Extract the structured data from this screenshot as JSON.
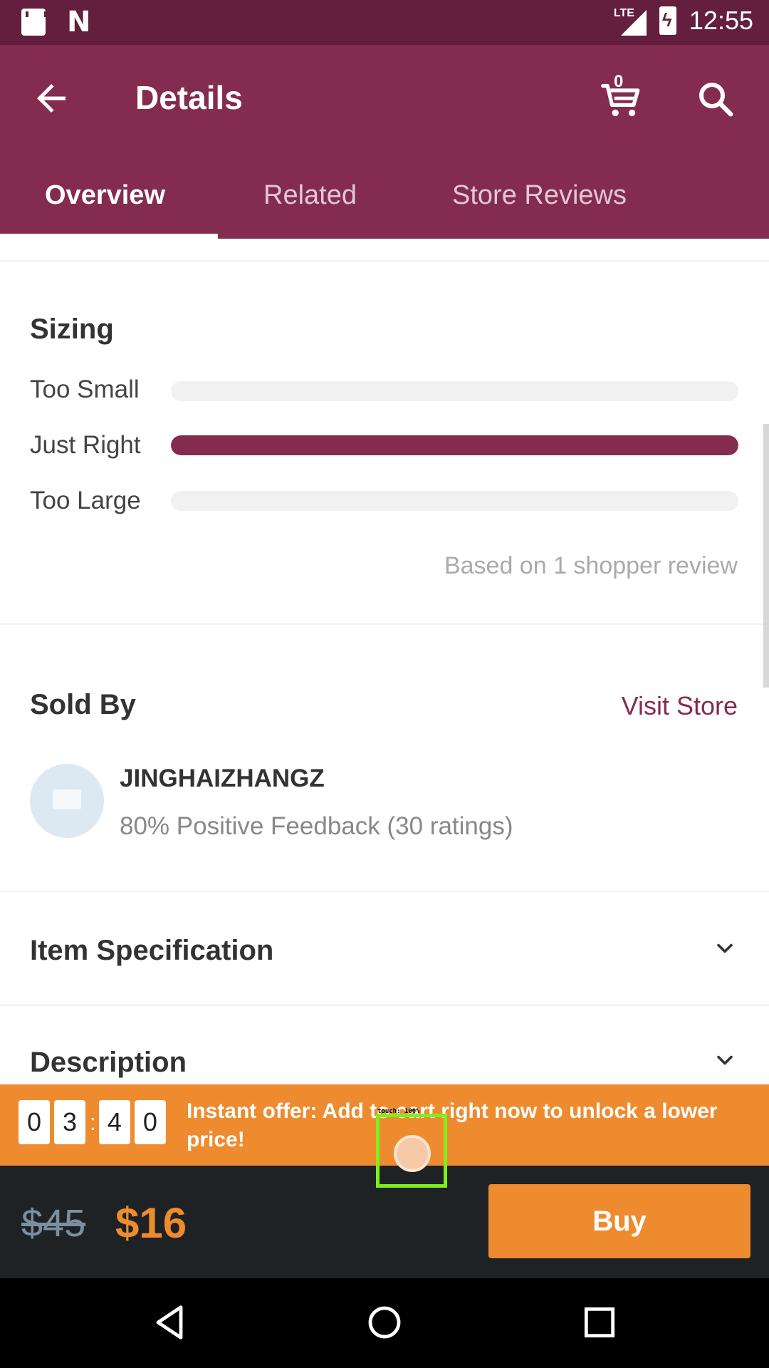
{
  "status_bar": {
    "time": "12:55",
    "network": "LTE"
  },
  "app_bar": {
    "title": "Details",
    "cart_count": "0"
  },
  "tabs": [
    {
      "label": "Overview",
      "active": true
    },
    {
      "label": "Related",
      "active": false
    },
    {
      "label": "Store Reviews",
      "active": false
    }
  ],
  "sizing": {
    "title": "Sizing",
    "rows": [
      {
        "label": "Too Small",
        "fraction": 0
      },
      {
        "label": "Just Right",
        "fraction": 1
      },
      {
        "label": "Too Large",
        "fraction": 0
      }
    ],
    "based_on": "Based on 1 shopper review"
  },
  "sold_by": {
    "title": "Sold By",
    "visit_store": "Visit Store",
    "store_name": "JINGHAIZHANGZ",
    "feedback": "80% Positive Feedback (30 ratings)"
  },
  "sections": {
    "item_spec": "Item Specification",
    "description": "Description"
  },
  "offer": {
    "timer_digits": [
      "0",
      "3",
      "4",
      "0"
    ],
    "separator": ":",
    "text": "Instant offer: Add to cart right now to unlock a lower price!",
    "touch_label": "touch: 100%"
  },
  "buy_bar": {
    "old_price": "$45",
    "new_price": "$16",
    "buy_label": "Buy"
  },
  "colors": {
    "brand": "#842b50",
    "status_bar": "#631f3d",
    "accent": "#ee8b2e",
    "buy_bar": "#1f2224"
  },
  "icons": [
    "sd-card-icon",
    "n-icon",
    "lte-signal-icon",
    "battery-charging-icon",
    "back-arrow-icon",
    "cart-icon",
    "search-icon",
    "chevron-down-icon",
    "store-avatar-icon",
    "nav-back-icon",
    "nav-home-icon",
    "nav-recents-icon"
  ]
}
